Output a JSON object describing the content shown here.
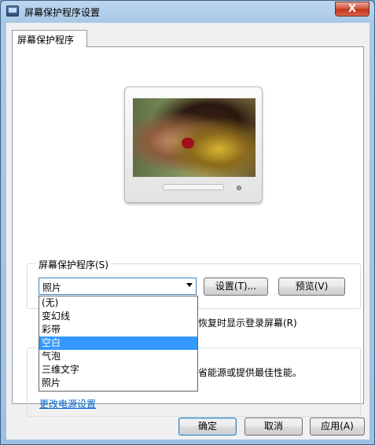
{
  "window": {
    "title": "屏幕保护程序设置",
    "close_label": "X"
  },
  "tab": {
    "label": "屏幕保护程序"
  },
  "screensaver_group": {
    "label": "屏幕保护程序(S)",
    "selected": "照片",
    "settings_button": "设置(T)...",
    "preview_button": "预览(V)",
    "resume_text": "恢复时显示登录屏幕(R)"
  },
  "dropdown": {
    "options": [
      "(无)",
      "变幻线",
      "彩带",
      "空白",
      "气泡",
      "三维文字",
      "照片"
    ],
    "highlighted": "空白"
  },
  "power_group": {
    "text": "省能源或提供最佳性能。",
    "link": "更改电源设置"
  },
  "buttons": {
    "ok": "确定",
    "cancel": "取消",
    "apply": "应用(A)"
  }
}
